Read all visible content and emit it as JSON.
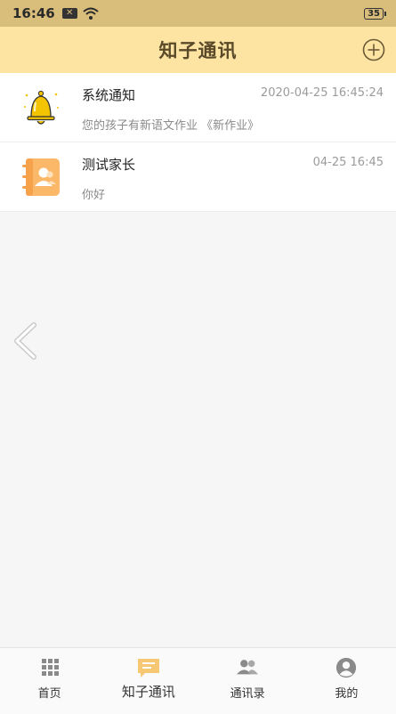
{
  "status_bar": {
    "time": "16:46",
    "notification_badge": "✕",
    "battery": "35"
  },
  "header": {
    "title": "知子通讯",
    "add_icon": "plus-circle-icon"
  },
  "conversations": [
    {
      "name": "系统通知",
      "time": "2020-04-25 16:45:24",
      "preview": "您的孩子有新语文作业 《新作业》",
      "icon": "bell-icon"
    },
    {
      "name": "测试家长",
      "time": "04-25 16:45",
      "preview": "你好",
      "icon": "contact-book-icon"
    }
  ],
  "tabs": [
    {
      "label": "首页",
      "icon": "grid-icon"
    },
    {
      "label": "知子通讯",
      "icon": "chat-bubble-icon",
      "active": true
    },
    {
      "label": "通讯录",
      "icon": "people-icon"
    },
    {
      "label": "我的",
      "icon": "user-circle-icon"
    }
  ],
  "colors": {
    "header_bg": "#fde4a3",
    "status_bg": "#d9bd7b",
    "accent": "#f7c873",
    "bell": "#f5c400"
  }
}
